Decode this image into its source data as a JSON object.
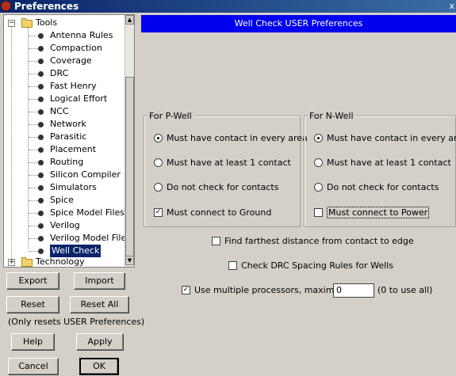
{
  "window": {
    "title": "Preferences",
    "close_symbol": "x"
  },
  "tree": {
    "tools_label": "Tools",
    "items": [
      "Antenna Rules",
      "Compaction",
      "Coverage",
      "DRC",
      "Fast Henry",
      "Logical Effort",
      "NCC",
      "Network",
      "Parasitic",
      "Placement",
      "Routing",
      "Silicon Compiler",
      "Simulators",
      "Spice",
      "Spice Model Files",
      "Verilog",
      "Verilog Model Files",
      "Well Check"
    ],
    "selected": "Well Check",
    "technology_label": "Technology",
    "expander_minus": "−",
    "expander_plus": "+"
  },
  "buttons": {
    "export": "Export",
    "import": "Import",
    "reset": "Reset",
    "reset_all": "Reset All",
    "reset_note": "(Only resets USER Preferences)",
    "help": "Help",
    "apply": "Apply",
    "cancel": "Cancel",
    "ok": "OK"
  },
  "panel": {
    "title": "Well Check USER Preferences",
    "pwell": {
      "legend": "For P-Well",
      "opt_every": "Must have contact in every area",
      "opt_one": "Must have at least 1 contact",
      "opt_none": "Do not check for contacts",
      "connect": "Must connect to Ground",
      "connect_checked": true,
      "selected": "every"
    },
    "nwell": {
      "legend": "For N-Well",
      "opt_every": "Must have contact in every area",
      "opt_one": "Must have at least 1 contact",
      "opt_none": "Do not check for contacts",
      "connect": "Must connect to Power",
      "connect_checked": false,
      "selected": "every"
    },
    "farthest": "Find farthest distance from contact to edge",
    "drc_spacing": "Check DRC Spacing Rules for Wells",
    "multi_proc": "Use multiple processors, maximum:",
    "multi_proc_checked": true,
    "max_value": "0",
    "max_hint": "(0 to use all)",
    "check_mark": "✓"
  }
}
